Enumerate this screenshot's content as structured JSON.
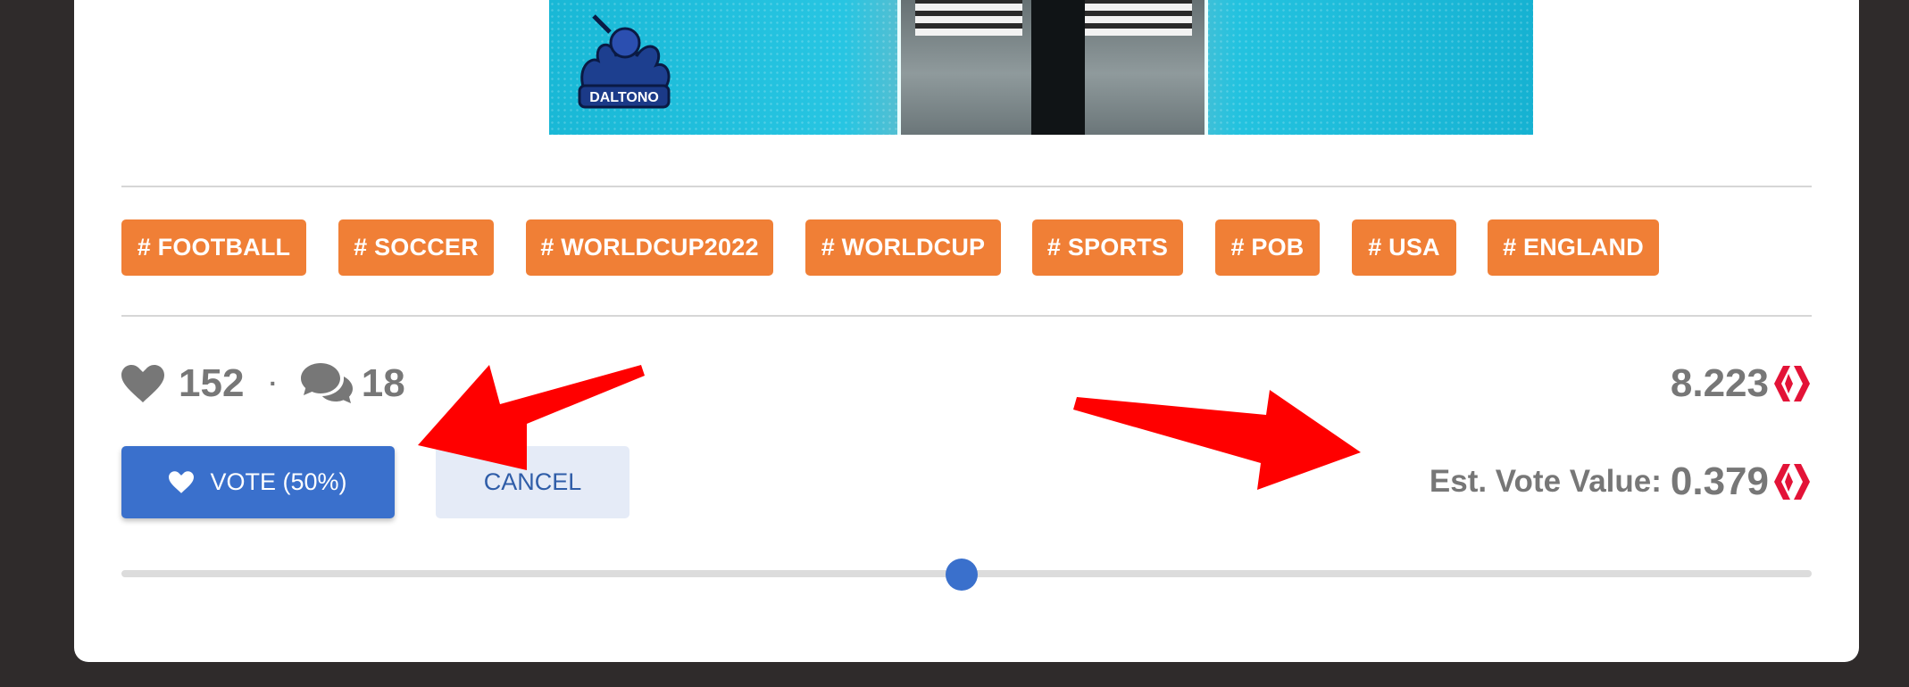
{
  "post": {
    "hero_image": {
      "logo_text": "DALTONO"
    },
    "tags": [
      "# FOOTBALL",
      "# SOCCER",
      "# WORLDCUP2022",
      "# WORLDCUP",
      "# SPORTS",
      "# POB",
      "# USA",
      "# ENGLAND"
    ],
    "stats": {
      "votes_count": "152",
      "separator": "·",
      "comments_count": "18"
    },
    "payout": {
      "value": "8.223",
      "currency_icon": "hive-logo-icon"
    }
  },
  "voting": {
    "vote_button_label": "VOTE (50%)",
    "cancel_button_label": "CANCEL",
    "est_label": "Est. Vote Value:",
    "est_value": "0.379",
    "weight_percent": 50
  },
  "annotations": {
    "arrow_color": "#ff0000",
    "arrows": [
      "arrow pointing to vote button",
      "arrow pointing to est. vote value"
    ]
  },
  "colors": {
    "tag_bg": "#f07f36",
    "vote_blue": "#3a70cc",
    "hive_red": "#e31337",
    "muted_text": "#777777"
  }
}
